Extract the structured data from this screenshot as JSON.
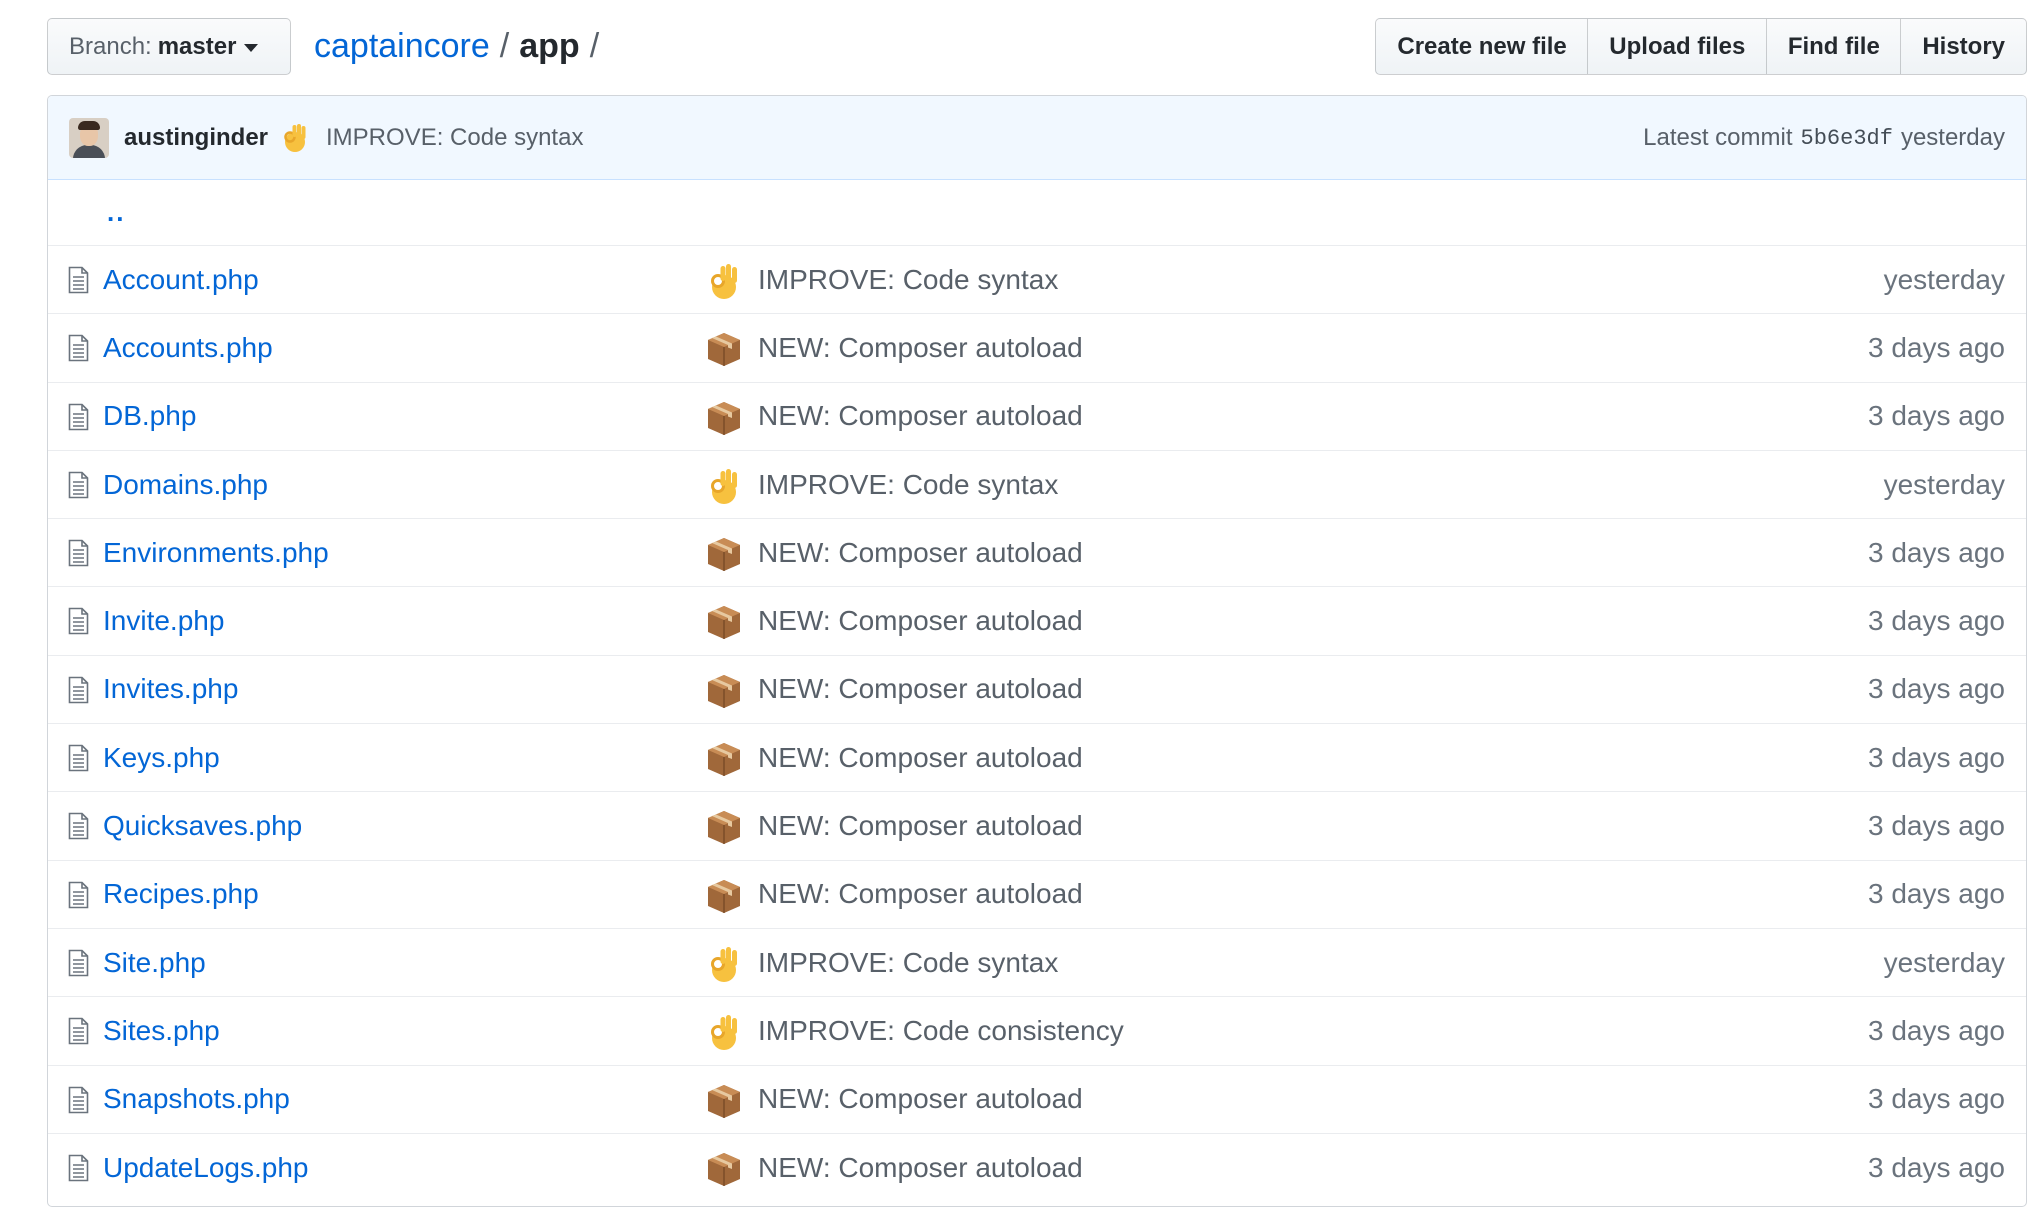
{
  "toolbar": {
    "branch_prefix": "Branch:",
    "branch_name": "master",
    "repo": "captaincore",
    "dir": "app",
    "sep1": "/",
    "sep2": "/",
    "buttons": [
      "Create new file",
      "Upload files",
      "Find file",
      "History"
    ]
  },
  "commit": {
    "author": "austinginder",
    "emoji": "ok-hand-icon",
    "message": "IMPROVE: Code syntax",
    "latest_label": "Latest commit",
    "sha": "5b6e3df",
    "when": "yesterday"
  },
  "parent_dir": "..",
  "files": [
    {
      "name": "Account.php",
      "icon": "ok-hand",
      "message": "IMPROVE: Code syntax",
      "age": "yesterday"
    },
    {
      "name": "Accounts.php",
      "icon": "package",
      "message": "NEW: Composer autoload",
      "age": "3 days ago"
    },
    {
      "name": "DB.php",
      "icon": "package",
      "message": "NEW: Composer autoload",
      "age": "3 days ago"
    },
    {
      "name": "Domains.php",
      "icon": "ok-hand",
      "message": "IMPROVE: Code syntax",
      "age": "yesterday"
    },
    {
      "name": "Environments.php",
      "icon": "package",
      "message": "NEW: Composer autoload",
      "age": "3 days ago"
    },
    {
      "name": "Invite.php",
      "icon": "package",
      "message": "NEW: Composer autoload",
      "age": "3 days ago"
    },
    {
      "name": "Invites.php",
      "icon": "package",
      "message": "NEW: Composer autoload",
      "age": "3 days ago"
    },
    {
      "name": "Keys.php",
      "icon": "package",
      "message": "NEW: Composer autoload",
      "age": "3 days ago"
    },
    {
      "name": "Quicksaves.php",
      "icon": "package",
      "message": "NEW: Composer autoload",
      "age": "3 days ago"
    },
    {
      "name": "Recipes.php",
      "icon": "package",
      "message": "NEW: Composer autoload",
      "age": "3 days ago"
    },
    {
      "name": "Site.php",
      "icon": "ok-hand",
      "message": "IMPROVE: Code syntax",
      "age": "yesterday"
    },
    {
      "name": "Sites.php",
      "icon": "ok-hand",
      "message": "IMPROVE: Code consistency",
      "age": "3 days ago"
    },
    {
      "name": "Snapshots.php",
      "icon": "package",
      "message": "NEW: Composer autoload",
      "age": "3 days ago"
    },
    {
      "name": "UpdateLogs.php",
      "icon": "package",
      "message": "NEW: Composer autoload",
      "age": "3 days ago"
    }
  ],
  "colors": {
    "link": "#0366d6",
    "tease_bg": "#f1f8ff",
    "border": "#d1d5da"
  }
}
